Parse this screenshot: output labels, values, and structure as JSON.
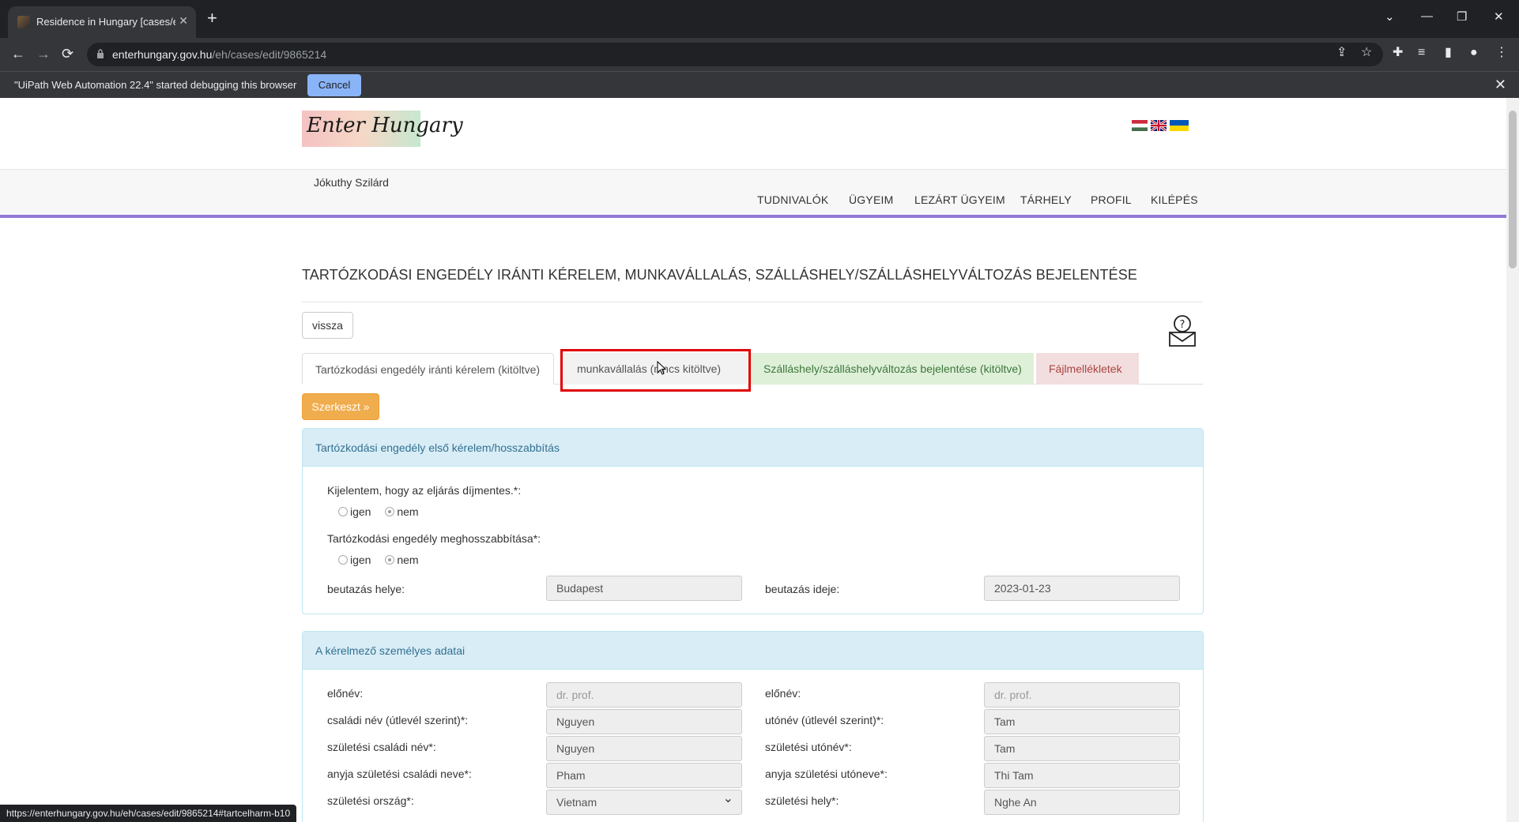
{
  "browser": {
    "tab_title": "Residence in Hungary [cases/edit",
    "tab_close": "✕",
    "new_tab": "+",
    "url_host": "enterhungary.gov.hu",
    "url_path": "/eh/cases/edit/9865214",
    "infobar_text": "\"UiPath Web Automation 22.4\" started debugging this browser",
    "infobar_cancel": "Cancel",
    "infobar_close": "✕",
    "status_url": "https://enterhungary.gov.hu/eh/cases/edit/9865214#tartcelharm-b10",
    "icons": {
      "back": "←",
      "forward": "→",
      "reload": "⟳",
      "share": "⇪",
      "star": "☆",
      "extensions": "✚",
      "media": "≡",
      "sidepanel": "▮",
      "profile": "●",
      "menu": "⋮",
      "tab_search": "⌄",
      "minimize": "—",
      "restore": "❐",
      "close": "✕"
    }
  },
  "site": {
    "logo_text": "Enter Hungary",
    "user_name": "Jókuthy Szilárd",
    "menu": [
      "TUDNIVALÓK",
      "ÜGYEIM",
      "LEZÁRT ÜGYEIM",
      "TÁRHELY",
      "PROFIL",
      "KILÉPÉS"
    ]
  },
  "page": {
    "title": "TARTÓZKODÁSI ENGEDÉLY IRÁNTI KÉRELEM, MUNKAVÁLLALÁS, SZÁLLÁSHELY/SZÁLLÁSHELYVÁLTOZÁS BEJELENTÉSE",
    "back_button": "vissza",
    "edit_button": "Szerkeszt »",
    "tabs": [
      "Tartózkodási engedély iránti kérelem (kitöltve)",
      "munkavállalás (nincs kitöltve)",
      "Szálláshely/szálláshelyváltozás bejelentése (kitöltve)",
      "Fájlmellékletek"
    ]
  },
  "panel1": {
    "heading": "Tartózkodási engedély első kérelem/hosszabbítás",
    "q1": "Kijelentem, hogy az eljárás díjmentes.*:",
    "q2": "Tartózkodási engedély meghosszabbítása*:",
    "yes": "igen",
    "no": "nem",
    "entry_place_label": "beutazás helye:",
    "entry_place_value": "Budapest",
    "entry_date_label": "beutazás ideje:",
    "entry_date_value": "2023-01-23"
  },
  "panel2": {
    "heading": "A kérelmező személyes adatai",
    "rows": [
      {
        "l_label": "előnév:",
        "l_value": "dr.  prof.",
        "r_label": "előnév:",
        "r_value": "dr.  prof."
      },
      {
        "l_label": "családi név (útlevél szerint)*:",
        "l_value": "Nguyen",
        "r_label": "utónév (útlevél szerint)*:",
        "r_value": "Tam"
      },
      {
        "l_label": "születési családi név*:",
        "l_value": "Nguyen",
        "r_label": "születési utónév*:",
        "r_value": "Tam"
      },
      {
        "l_label": "anyja születési családi neve*:",
        "l_value": "Pham",
        "r_label": "anyja születési utóneve*:",
        "r_value": "Thi Tam"
      },
      {
        "l_label": "születési ország*:",
        "l_value": "Vietnam",
        "r_label": "születési hely*:",
        "r_value": "Nghe An"
      }
    ]
  }
}
